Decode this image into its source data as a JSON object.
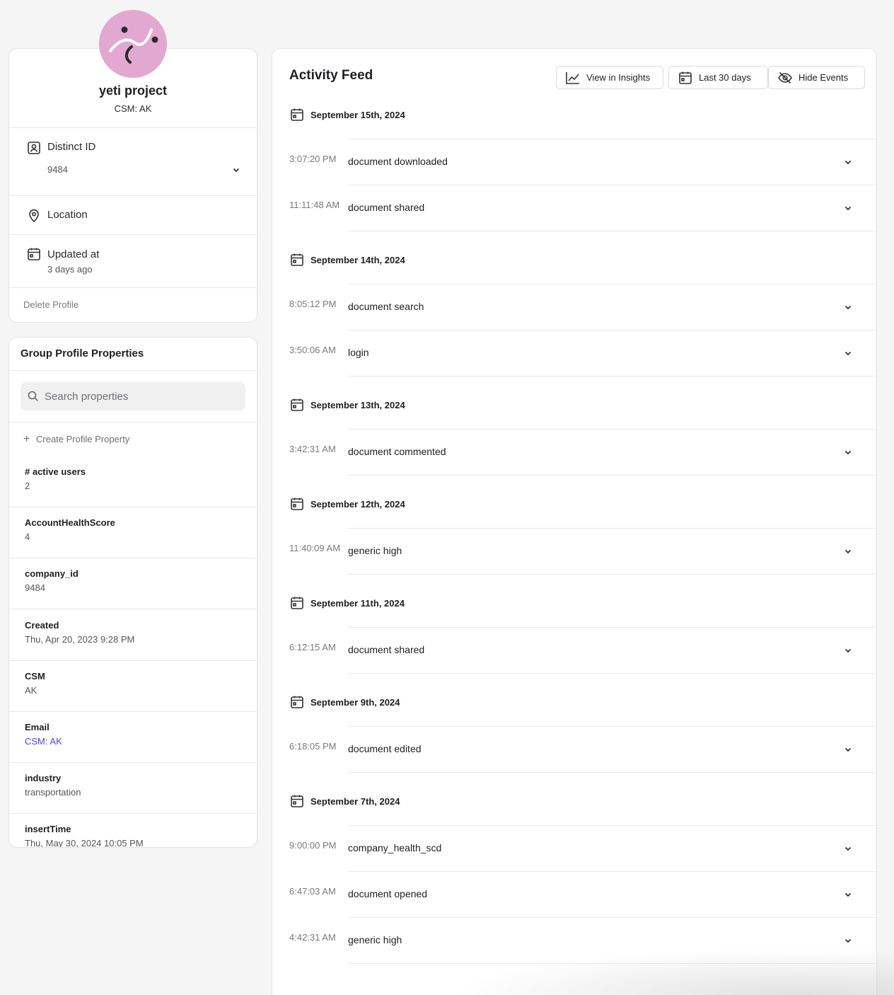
{
  "profile": {
    "name": "yeti project",
    "subtitle": "CSM: AK",
    "avatar_color": "#e3a8d1",
    "distinct_id_label": "Distinct ID",
    "distinct_id_value": "9484",
    "location_label": "Location",
    "updated_label": "Updated at",
    "updated_value": "3 days ago",
    "delete_label": "Delete Profile"
  },
  "properties": {
    "title": "Group Profile Properties",
    "search_placeholder": "Search properties",
    "create_label": "Create Profile Property",
    "items": [
      {
        "name": "# active users",
        "value": "2"
      },
      {
        "name": "AccountHealthScore",
        "value": "4"
      },
      {
        "name": "company_id",
        "value": "9484"
      },
      {
        "name": "Created",
        "value": "Thu, Apr 20, 2023 9:28 PM"
      },
      {
        "name": "CSM",
        "value": "AK"
      },
      {
        "name": "Email",
        "value": "CSM: AK"
      },
      {
        "name": "industry",
        "value": "transportation"
      },
      {
        "name": "insertTime",
        "value": "Thu, May 30, 2024 10:05 PM"
      }
    ],
    "link_color": "#4f44e0"
  },
  "feed": {
    "title": "Activity Feed",
    "view_insights_label": "View in Insights",
    "date_range_label": "Last 30 days",
    "hide_events_label": "Hide Events",
    "days": [
      {
        "date": "September 15th, 2024",
        "events": [
          {
            "time": "3:07:20 PM",
            "name": "document downloaded"
          },
          {
            "time": "11:11:48 AM",
            "name": "document shared"
          }
        ]
      },
      {
        "date": "September 14th, 2024",
        "events": [
          {
            "time": "8:05:12 PM",
            "name": "document search"
          },
          {
            "time": "3:50:06 AM",
            "name": "login"
          }
        ]
      },
      {
        "date": "September 13th, 2024",
        "events": [
          {
            "time": "3:42:31 AM",
            "name": "document commented"
          }
        ]
      },
      {
        "date": "September 12th, 2024",
        "events": [
          {
            "time": "11:40:09 AM",
            "name": "generic high"
          }
        ]
      },
      {
        "date": "September 11th, 2024",
        "events": [
          {
            "time": "6:12:15 AM",
            "name": "document shared"
          }
        ]
      },
      {
        "date": "September 9th, 2024",
        "events": [
          {
            "time": "6:18:05 PM",
            "name": "document edited"
          }
        ]
      },
      {
        "date": "September 7th, 2024",
        "events": [
          {
            "time": "9:00:00 PM",
            "name": "company_health_scd"
          },
          {
            "time": "6:47:03 AM",
            "name": "document opened"
          },
          {
            "time": "4:42:31 AM",
            "name": "generic high"
          }
        ]
      }
    ]
  }
}
